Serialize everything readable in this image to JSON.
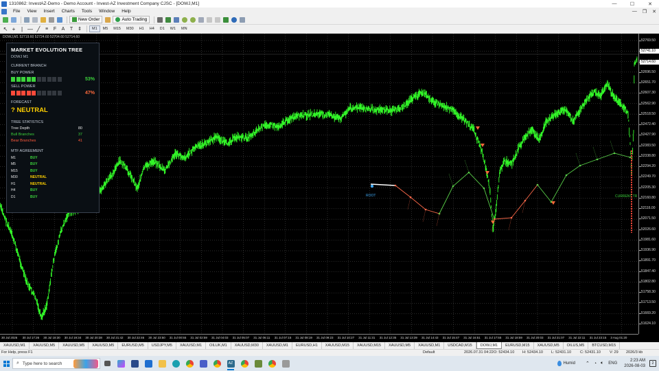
{
  "window": {
    "title": "1310862: InvestAZ-Demo - Demo Account - Invest-AZ Investment Company CJSC - [DOWJ,M1]",
    "controls": [
      "—",
      "☐",
      "✕"
    ]
  },
  "menu": {
    "items": [
      "File",
      "View",
      "Insert",
      "Charts",
      "Tools",
      "Window",
      "Help"
    ],
    "mdi_controls": [
      "—",
      "❐",
      "✕"
    ]
  },
  "toolbar": {
    "new_order": "New Order",
    "auto_trading": "Auto Trading",
    "timeframes": [
      "M1",
      "M5",
      "M15",
      "M30",
      "H1",
      "H4",
      "D1",
      "W1",
      "MN"
    ],
    "active_timeframe": "M1"
  },
  "chart": {
    "header": "DOWJ,M1  52719.60 52724.60 52704.60 52714.60",
    "price_labels": [
      "52769.50",
      "52741.10",
      "52714.60",
      "52696.50",
      "52651.70",
      "52607.30",
      "52562.90",
      "52518.50",
      "52472.40",
      "52427.90",
      "52383.50",
      "52338.80",
      "52294.20",
      "52249.70",
      "52205.30",
      "52160.80",
      "52116.00",
      "52071.50",
      "52026.60",
      "51981.60",
      "51936.90",
      "51891.70",
      "51847.40",
      "51802.80",
      "51758.30",
      "51713.50",
      "51669.20",
      "51624.10"
    ],
    "current_price": "52714.60",
    "ask_price": "52741.10",
    "time_labels": [
      "30 Jul 2026",
      "30 Jul 17:26",
      "30 Jul 18:30",
      "30 Jul 19:34",
      "30 Jul 20:38",
      "30 Jul 21:42",
      "30 Jul 22:46",
      "30 Jul 23:50",
      "31 Jul 00:55",
      "31 Jul 02:59",
      "31 Jul 04:03",
      "31 Jul 05:07",
      "31 Jul 06:11",
      "31 Jul 07:15",
      "31 Jul 08:19",
      "31 Jul 09:23",
      "31 Jul 10:27",
      "31 Jul 11:31",
      "31 Jul 12:35",
      "31 Jul 13:39",
      "31 Jul 14:43",
      "31 Jul 15:47",
      "31 Jul 16:51",
      "31 Jul 17:55",
      "31 Jul 18:59",
      "31 Jul 20:03",
      "31 Jul 21:07",
      "31 Jul 22:11",
      "31 Jul 23:15",
      "3 Aug 01:20"
    ],
    "annotations": {
      "root": "ROOT",
      "current": "CURRENT TR"
    }
  },
  "panel": {
    "title": "MARKET EVOLUTION TREE",
    "symbol": "DOWJ M1",
    "current_branch_label": "CURRENT BRANCH",
    "buy_power_label": "BUY POWER",
    "buy_power_pct": "53%",
    "buy_power_fraction": 0.53,
    "sell_power_label": "SELL POWER",
    "sell_power_pct": "47%",
    "sell_power_fraction": 0.47,
    "forecast_label": "FORECAST",
    "forecast_value": "? NEUTRAL",
    "tree_stats_label": "TREE STATISTICS",
    "stats": [
      {
        "label": "Tree Depth",
        "value": "80",
        "color": "#e8e8e8"
      },
      {
        "label": "Bull Branches",
        "value": "37",
        "color": "#3cd33c"
      },
      {
        "label": "Bear Branches",
        "value": "41",
        "color": "#ff5a3c"
      }
    ],
    "mtf_label": "MTF AGREEMENT",
    "mtf": [
      {
        "tf": "M1",
        "signal": "BUY"
      },
      {
        "tf": "M5",
        "signal": "BUY"
      },
      {
        "tf": "M15",
        "signal": "BUY"
      },
      {
        "tf": "M30",
        "signal": "NEUTRAL"
      },
      {
        "tf": "H1",
        "signal": "NEUTRAL"
      },
      {
        "tf": "H4",
        "signal": "BUY"
      },
      {
        "tf": "D1",
        "signal": "BUY"
      }
    ],
    "colors": {
      "buy": "#3cd33c",
      "sell": "#ff4a3a",
      "neutral": "#ffd000"
    }
  },
  "symbol_tabs": [
    "XAUUSD,M1",
    "XAUUSD,M5",
    "XAUUSD,M5",
    "XAUUSD,M5",
    "EURUSD,M5",
    "USDJPY,M5",
    "XAUUSD,M1",
    "OILUK,M1",
    "XAUUSD,M30",
    "XAUUSD,M1",
    "EURUSD,H1",
    "XAUUSD,M15",
    "XAUUSD,M15",
    "XAUUSD,M5",
    "XAUUSD,M1",
    "USDCAD,M15",
    "DOWJ,M1",
    "EURUSD,M15",
    "XAUUSD,M5",
    "OILUS,M5",
    "BTCUSD,M15"
  ],
  "active_symbol_tab": "DOWJ,M1",
  "status": {
    "help": "For Help, press F1",
    "profile": "Default",
    "datetime": "2026.07.31 04:22",
    "open": "O: 52434.10",
    "high": "H: 52434.10",
    "low": "L: 52431.10",
    "close": "C: 52431.10",
    "volume": "V: 29",
    "traffic": "2026/3 kb"
  },
  "taskbar": {
    "search_placeholder": "Type here to search",
    "weather": "Humid",
    "language": "ENG",
    "time": "2:23 AM",
    "date": "2026-08-03",
    "notifications": "2"
  }
}
